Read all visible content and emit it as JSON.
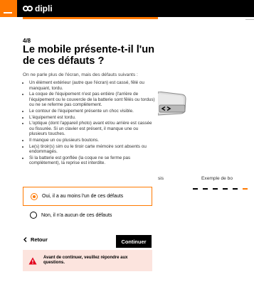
{
  "header": {
    "brand": "dipli",
    "colors": {
      "orange": "#ff7900",
      "bar": "#000000"
    },
    "progress_fraction": 0.5
  },
  "main": {
    "step": "4/8",
    "title": "Le mobile présente-t-il l'un de ces défauts ?",
    "intro": "On ne parle plus de l'écran, mais des défauts suivants :",
    "defects": [
      "Un élément extérieur (autre que l'écran) est cassé, fêlé ou manquant, tordu.",
      "La coque de l'équipement n'est pas entière (l'arrière de l'équipement ou le couvercle de la batterie sont fêlés ou tordus) ou ne se referme pas complètement.",
      "Le contour de l'équipement présente un choc visible.",
      "L'équipement est tordu.",
      "L'optique (dont l'appareil photo) avant et/ou arrière est cassée ou fissurée. Si un clavier est présent, il manque une ou plusieurs touches.",
      "Il manque un ou plusieurs boutons.",
      "Le(s) tiroir(s) sim ou le tiroir carte mémoire sont absents ou endommagés.",
      "Si la batterie est gonflée (la coque ne se ferme pas complètement), la reprise est interdite."
    ]
  },
  "carousel": {
    "left_caption": "sis",
    "right_caption": "Exemple de bo",
    "dots": 6,
    "active_dot": 5
  },
  "options": {
    "yes": "Oui, il a au moins l'un de ces défauts",
    "no": "Non, il n'a aucun de ces défauts",
    "selected": "yes"
  },
  "nav": {
    "back": "Retour",
    "continue": "Continuer"
  },
  "alert": {
    "text": "Avant de continuer, veuillez répondre aux questions.",
    "icon": "warning-icon",
    "color": "#e2001a"
  }
}
